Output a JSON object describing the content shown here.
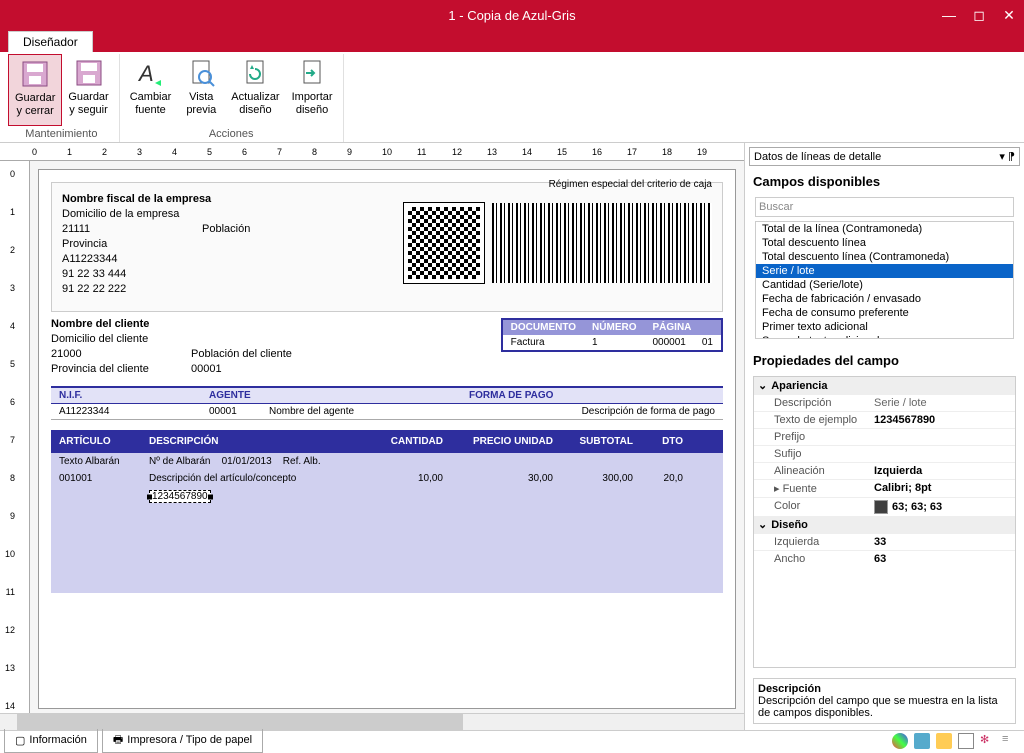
{
  "window": {
    "title": "1 - Copia de Azul-Gris"
  },
  "tabs": {
    "designer": "Diseñador"
  },
  "ribbon": {
    "groups": [
      {
        "label": "Mantenimiento",
        "buttons": [
          {
            "label": "Guardar\ny cerrar",
            "active": true
          },
          {
            "label": "Guardar\ny seguir"
          }
        ]
      },
      {
        "label": "Acciones",
        "buttons": [
          {
            "label": "Cambiar\nfuente"
          },
          {
            "label": "Vista\nprevia"
          },
          {
            "label": "Actualizar\ndiseño"
          },
          {
            "label": "Importar\ndiseño"
          }
        ]
      }
    ]
  },
  "document": {
    "company": {
      "name": "Nombre fiscal de la empresa",
      "address": "Domicilio de la empresa",
      "postal": "21111",
      "city": "Población",
      "province": "Provincia",
      "nif": "A11223344",
      "phone": "91 22 33 444",
      "fax": "91 22 22 222"
    },
    "regimen": "Régimen especial del criterio de caja",
    "client": {
      "name": "Nombre del cliente",
      "address": "Domicilio del cliente",
      "postal": "21000",
      "city": "Población del cliente",
      "province": "Provincia del cliente",
      "code": "00001"
    },
    "doc_header": {
      "cols": [
        "DOCUMENTO",
        "NÚMERO",
        "PÁGINA"
      ],
      "vals": [
        "Factura",
        "1",
        "000001",
        "01"
      ]
    },
    "nif_header": [
      "N.I.F.",
      "AGENTE",
      "FORMA DE PAGO"
    ],
    "nif_data": [
      "A11223344",
      "00001",
      "Nombre del agente",
      "Descripción de forma de pago"
    ],
    "items_header": [
      "ARTÍCULO",
      "DESCRIPCIÓN",
      "CANTIDAD",
      "PRECIO UNIDAD",
      "SUBTOTAL",
      "DTO"
    ],
    "items": {
      "r1": [
        "Texto Albarán",
        "Nº de Albarán",
        "01/01/2013",
        "Ref. Alb."
      ],
      "r2": [
        "001001",
        "Descripción del artículo/concepto",
        "10,00",
        "30,00",
        "300,00",
        "20,0"
      ],
      "r3_serie": "1234567890"
    }
  },
  "right_panel": {
    "dropdown": "Datos de líneas de detalle",
    "fields_title": "Campos disponibles",
    "search_placeholder": "Buscar",
    "fields": [
      "Total de la línea  (Contramoneda)",
      "Total descuento línea",
      "Total descuento línea (Contramoneda)",
      "Serie / lote",
      "Cantidad (Serie/lote)",
      "Fecha de  fabricación / envasado",
      "Fecha de  consumo preferente",
      "Primer texto adicional",
      "Segundo texto adicional"
    ],
    "selected_field_index": 3,
    "props_title": "Propiedades del campo",
    "props": {
      "appearance": "Apariencia",
      "descripcion_k": "Descripción",
      "descripcion_v": "Serie / lote",
      "texto_k": "Texto de ejemplo",
      "texto_v": "1234567890",
      "prefijo_k": "Prefijo",
      "prefijo_v": "",
      "sufijo_k": "Sufijo",
      "sufijo_v": "",
      "alineacion_k": "Alineación",
      "alineacion_v": "Izquierda",
      "fuente_k": "Fuente",
      "fuente_v": "Calibri; 8pt",
      "color_k": "Color",
      "color_v": "63; 63; 63",
      "diseno": "Diseño",
      "izq_k": "Izquierda",
      "izq_v": "33",
      "ancho_k": "Ancho",
      "ancho_v": "63"
    },
    "hint_title": "Descripción",
    "hint_text": "Descripción del campo que se muestra en la lista de campos disponibles."
  },
  "statusbar": {
    "info": "Información",
    "printer": "Impresora / Tipo de papel"
  }
}
